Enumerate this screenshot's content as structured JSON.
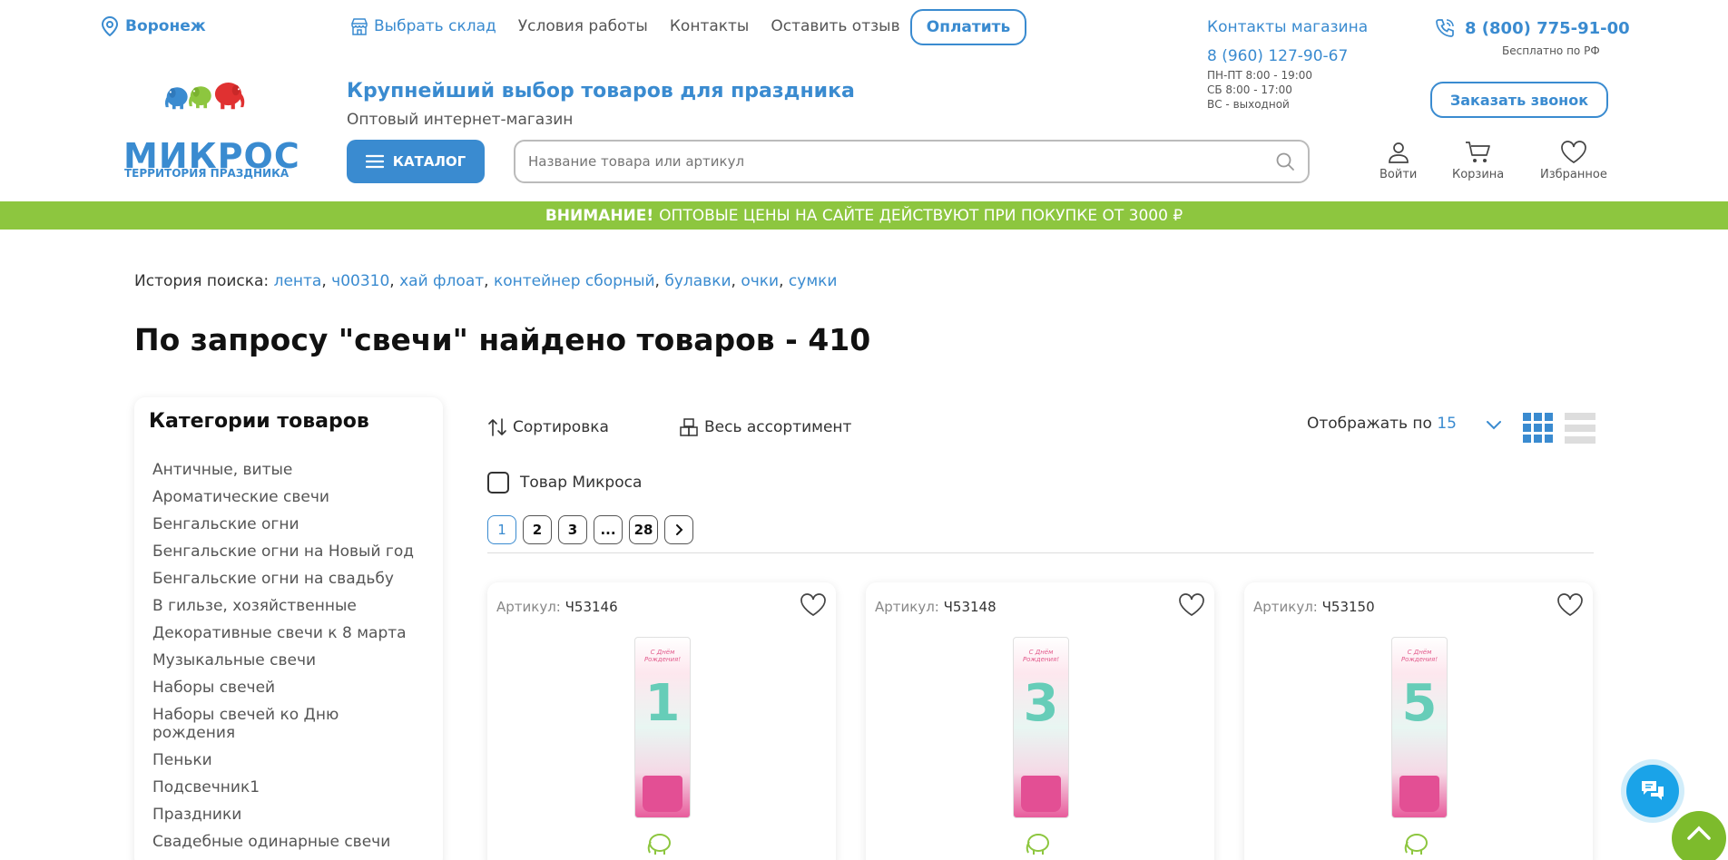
{
  "header": {
    "city": "Воронеж",
    "nav": [
      "Выбрать склад",
      "Условия работы",
      "Контакты",
      "Оставить отзыв"
    ],
    "pay_button": "Оплатить",
    "shop_contacts_label": "Контакты магазина",
    "shop_phone": "8 (960) 127-90-67",
    "hours": [
      "ПН-ПТ 8:00 - 19:00",
      "СБ 8:00 - 17:00",
      "ВС - выходной"
    ],
    "main_phone": "8 (800) 775-91-00",
    "free_note": "Бесплатно по РФ",
    "callback_button": "Заказать звонок",
    "logo_text": "МИКРОС",
    "logo_sub": "ТЕРРИТОРИЯ ПРАЗДНИКА",
    "slogan": "Крупнейший выбор товаров для праздника",
    "subslogan": "Оптовый интернет-магазин",
    "catalog_button": "КАТАЛОГ",
    "search_placeholder": "Название товара или артикул",
    "actions": {
      "login": "Войти",
      "cart": "Корзина",
      "favorites": "Избранное"
    }
  },
  "banner": {
    "bold": "ВНИМАНИЕ!",
    "text": "ОПТОВЫЕ ЦЕНЫ НА САЙТЕ ДЕЙСТВУЮТ ПРИ ПОКУПКЕ ОТ 3000 ₽"
  },
  "history": {
    "label": "История поиска:",
    "tags": [
      "лента",
      "ч00310",
      "хай флоат",
      "контейнер сборный",
      "булавки",
      "очки",
      "сумки"
    ]
  },
  "result_title": "По запросу \"свечи\" найдено товаров - 410",
  "sidebar": {
    "title": "Категории товаров",
    "items": [
      "Античные, витые",
      "Ароматические свечи",
      "Бенгальские огни",
      "Бенгальские огни на Новый год",
      "Бенгальские огни на свадьбу",
      "В гильзе, хозяйственные",
      "Декоративные свечи к 8 марта",
      "Музыкальные свечи",
      "Наборы свечей",
      "Наборы свечей ко Дню рождения",
      "Пеньки",
      "Подсвечник1",
      "Праздники",
      "Свадебные одинарные свечи"
    ]
  },
  "toolbar": {
    "sort_label": "Сортировка",
    "assortment_label": "Весь ассортимент",
    "per_page_label": "Отображать по",
    "per_page_value": "15",
    "own_filter_label": "Товар Микроса"
  },
  "pagination": {
    "pages": [
      "1",
      "2",
      "3",
      "...",
      "28"
    ],
    "current": "1"
  },
  "products": [
    {
      "article_label": "Артикул:",
      "article": "Ч53146",
      "digit": "1",
      "package_text": "С Днём Рождения!"
    },
    {
      "article_label": "Артикул:",
      "article": "Ч53148",
      "digit": "3",
      "package_text": "С Днём Рождения!"
    },
    {
      "article_label": "Артикул:",
      "article": "Ч53150",
      "digit": "5",
      "package_text": "С Днём Рождения!"
    }
  ],
  "colors": {
    "accent": "#3a8bd0",
    "banner": "#8dc63f",
    "chat": "#1aa3e8",
    "up": "#7dbb2c"
  }
}
